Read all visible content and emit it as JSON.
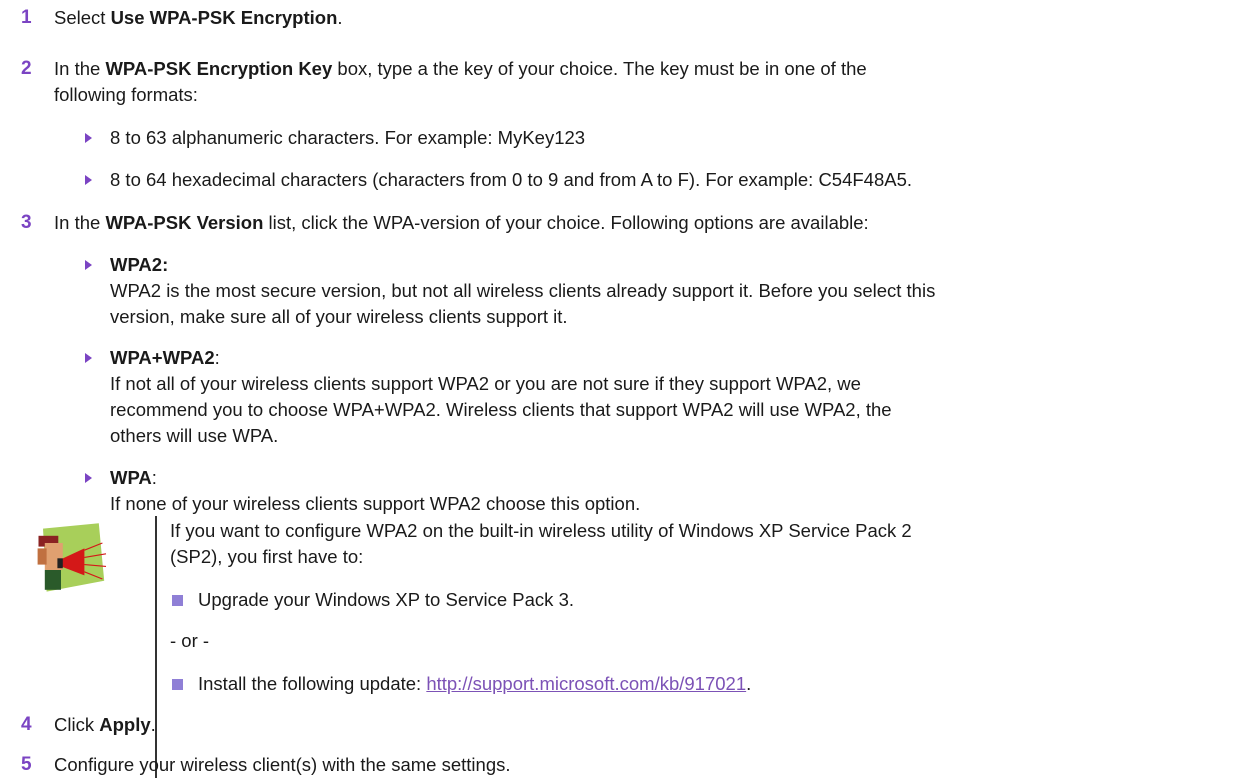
{
  "steps": {
    "s1": {
      "num": "1",
      "pre": "Select ",
      "bold": "Use WPA-PSK Encryption",
      "post": "."
    },
    "s2": {
      "num": "2",
      "pre": "In the ",
      "bold": "WPA-PSK Encryption Key",
      "post": " box, type a the key of your choice. The key must be in one of the",
      "cont": "following formats:"
    },
    "s2_b1": "8 to 63 alphanumeric characters. For example: MyKey123",
    "s2_b2": "8 to 64 hexadecimal characters (characters from 0 to 9 and from A to F). For example: C54F48A5.",
    "s3": {
      "num": "3",
      "pre": "In the ",
      "bold": "WPA-PSK Version",
      "post": " list, click the WPA-version of your choice. Following options are available:"
    },
    "opt1": {
      "title": "WPA2:",
      "l1": "WPA2 is the most secure version, but not all wireless clients already support it. Before you select this",
      "l2": "version, make sure all of your wireless clients support it."
    },
    "opt2": {
      "title": "WPA+WPA2",
      "colon": ":",
      "l1": "If not all of your wireless clients support WPA2 or you are not sure if they support WPA2, we",
      "l2": "recommend you to choose WPA+WPA2. Wireless clients that support WPA2 will use WPA2, the",
      "l3": "others will use WPA."
    },
    "opt3": {
      "title": "WPA",
      "colon": ":",
      "l1": "If none of your wireless clients support WPA2 choose this option."
    },
    "s4": {
      "num": "4",
      "pre": "Click ",
      "bold": "Apply",
      "post": "."
    },
    "s5": {
      "num": "5",
      "text": "Configure your wireless client(s) with the same settings."
    }
  },
  "note": {
    "l1": "If you want to configure WPA2 on the built-in wireless utility of Windows XP Service Pack 2",
    "l2": "(SP2), you first have to:",
    "b1": "Upgrade your Windows XP to Service Pack 3.",
    "or": "- or -",
    "b2_pre": "Install the following update: ",
    "b2_link": "http://support.microsoft.com/kb/917021",
    "b2_post": "."
  },
  "colors": {
    "accent": "#7b44c3",
    "bullet_square": "#8f7fd6",
    "link": "#7c52b6"
  },
  "icons": {
    "note": "megaphone-person-icon"
  }
}
